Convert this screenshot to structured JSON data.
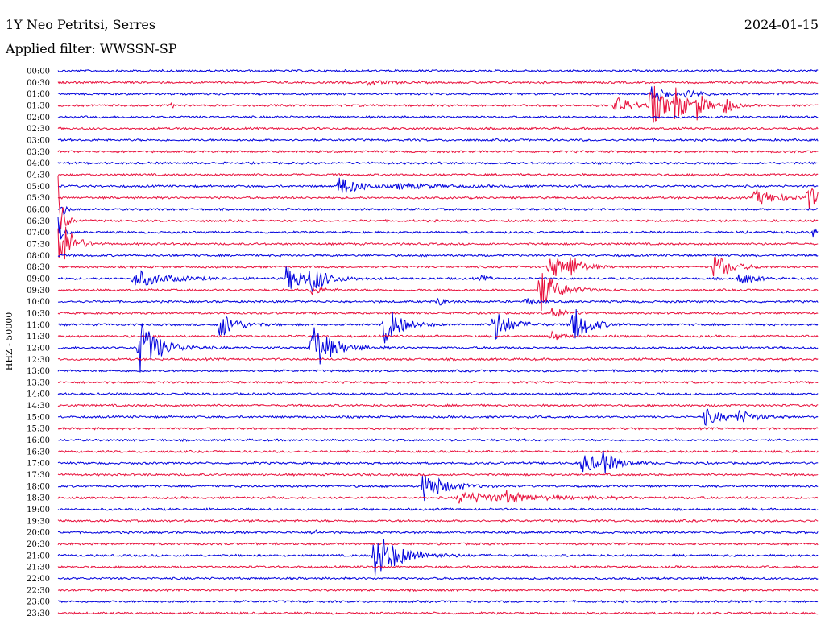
{
  "header": {
    "station": "1Y Neo Petritsi, Serres",
    "date": "2024-01-15",
    "filter": "Applied filter: WWSSN-SP"
  },
  "chart_data": {
    "type": "line",
    "ylabel": "HHZ - 50000",
    "colors": {
      "odd": "#0000dd",
      "even": "#e8103c"
    },
    "rows": [
      "00:00",
      "00:30",
      "01:00",
      "01:30",
      "02:00",
      "02:30",
      "03:00",
      "03:30",
      "04:00",
      "04:30",
      "05:00",
      "05:30",
      "06:00",
      "06:30",
      "07:00",
      "07:30",
      "08:00",
      "08:30",
      "09:00",
      "09:30",
      "10:00",
      "10:30",
      "11:00",
      "11:30",
      "12:00",
      "12:30",
      "13:00",
      "13:30",
      "14:00",
      "14:30",
      "15:00",
      "15:30",
      "16:00",
      "16:30",
      "17:00",
      "17:30",
      "18:00",
      "18:30",
      "19:00",
      "19:30",
      "20:00",
      "20:30",
      "21:00",
      "21:30",
      "22:00",
      "22:30",
      "23:00",
      "23:30"
    ],
    "x_range_minutes": [
      0,
      30
    ],
    "events": [
      {
        "row": 1,
        "t": 12.2,
        "amp": 3,
        "dur": 1.4
      },
      {
        "row": 2,
        "t": 23.5,
        "amp": 35,
        "dur": 0.5
      },
      {
        "row": 2,
        "t": 24.8,
        "amp": 5,
        "dur": 1.2
      },
      {
        "row": 3,
        "t": 4.5,
        "amp": 3,
        "dur": 0.2
      },
      {
        "row": 3,
        "t": 22.0,
        "amp": 12,
        "dur": 1.2
      },
      {
        "row": 3,
        "t": 23.4,
        "amp": 30,
        "dur": 1.0
      },
      {
        "row": 3,
        "t": 24.3,
        "amp": 22,
        "dur": 0.9
      },
      {
        "row": 3,
        "t": 25.2,
        "amp": 16,
        "dur": 0.8
      },
      {
        "row": 3,
        "t": 26.3,
        "amp": 12,
        "dur": 0.6
      },
      {
        "row": 10,
        "t": 11.1,
        "amp": 12,
        "dur": 1.6
      },
      {
        "row": 10,
        "t": 13.4,
        "amp": 3,
        "dur": 3.5
      },
      {
        "row": 11,
        "t": 27.5,
        "amp": 10,
        "dur": 1.8
      },
      {
        "row": 11,
        "t": 29.6,
        "amp": 14,
        "dur": 0.9
      },
      {
        "row": 12,
        "t": 0.2,
        "amp": 8,
        "dur": 0.3
      },
      {
        "row": 13,
        "t": 0.0,
        "amp": 55,
        "dur": 0.4
      },
      {
        "row": 14,
        "t": 0.0,
        "amp": 22,
        "dur": 0.3
      },
      {
        "row": 14,
        "t": 29.8,
        "amp": 6,
        "dur": 0.3
      },
      {
        "row": 15,
        "t": 0.05,
        "amp": 40,
        "dur": 0.9
      },
      {
        "row": 17,
        "t": 19.4,
        "amp": 16,
        "dur": 1.4
      },
      {
        "row": 17,
        "t": 20.2,
        "amp": 12,
        "dur": 0.8
      },
      {
        "row": 17,
        "t": 25.9,
        "amp": 18,
        "dur": 1.2
      },
      {
        "row": 18,
        "t": 3.0,
        "amp": 11,
        "dur": 2.5
      },
      {
        "row": 18,
        "t": 9.0,
        "amp": 15,
        "dur": 2.0
      },
      {
        "row": 18,
        "t": 10.0,
        "amp": 14,
        "dur": 1.0
      },
      {
        "row": 18,
        "t": 16.7,
        "amp": 3,
        "dur": 0.6
      },
      {
        "row": 18,
        "t": 26.9,
        "amp": 8,
        "dur": 1.0
      },
      {
        "row": 19,
        "t": 19.0,
        "amp": 28,
        "dur": 1.3
      },
      {
        "row": 19,
        "t": 10.0,
        "amp": 6,
        "dur": 0.8
      },
      {
        "row": 20,
        "t": 15.0,
        "amp": 5,
        "dur": 0.6
      },
      {
        "row": 20,
        "t": 18.5,
        "amp": 6,
        "dur": 0.5
      },
      {
        "row": 21,
        "t": 19.5,
        "amp": 8,
        "dur": 1.0
      },
      {
        "row": 22,
        "t": 6.4,
        "amp": 18,
        "dur": 1.2
      },
      {
        "row": 22,
        "t": 12.9,
        "amp": 26,
        "dur": 1.2
      },
      {
        "row": 22,
        "t": 17.2,
        "amp": 22,
        "dur": 1.2
      },
      {
        "row": 22,
        "t": 20.3,
        "amp": 26,
        "dur": 1.2
      },
      {
        "row": 23,
        "t": 19.5,
        "amp": 6,
        "dur": 0.8
      },
      {
        "row": 24,
        "t": 3.2,
        "amp": 36,
        "dur": 1.5
      },
      {
        "row": 24,
        "t": 10.0,
        "amp": 34,
        "dur": 1.5
      },
      {
        "row": 30,
        "t": 25.5,
        "amp": 10,
        "dur": 1.6
      },
      {
        "row": 30,
        "t": 26.8,
        "amp": 8,
        "dur": 1.2
      },
      {
        "row": 34,
        "t": 20.7,
        "amp": 14,
        "dur": 1.2
      },
      {
        "row": 34,
        "t": 21.4,
        "amp": 14,
        "dur": 1.2
      },
      {
        "row": 36,
        "t": 14.4,
        "amp": 20,
        "dur": 1.6
      },
      {
        "row": 37,
        "t": 15.8,
        "amp": 6,
        "dur": 6.0
      },
      {
        "row": 37,
        "t": 17.7,
        "amp": 6,
        "dur": 1.0
      },
      {
        "row": 40,
        "t": 10.1,
        "amp": 5,
        "dur": 0.3
      },
      {
        "row": 42,
        "t": 12.5,
        "amp": 30,
        "dur": 2.0
      }
    ]
  }
}
